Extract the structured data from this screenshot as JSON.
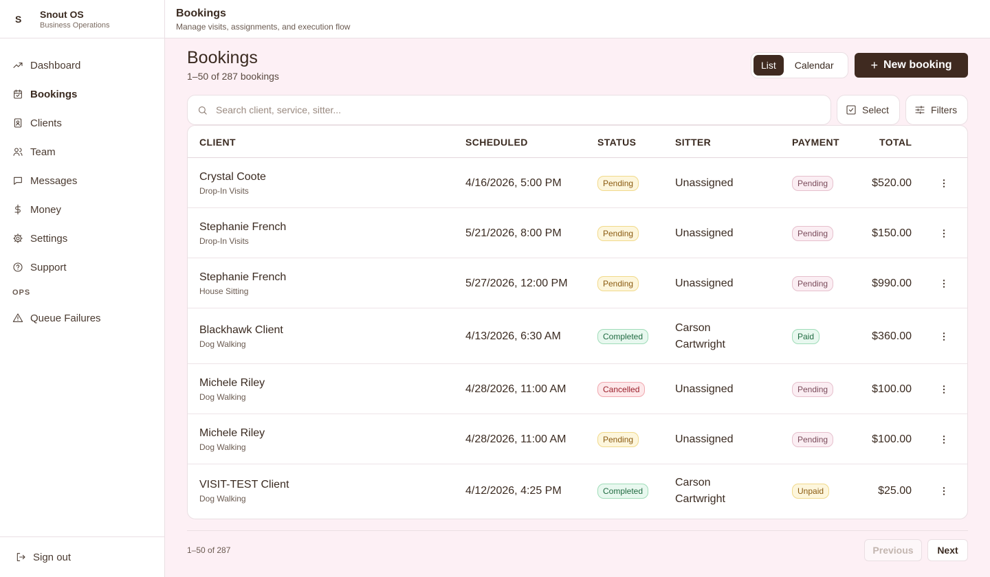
{
  "brand": {
    "mark": "S",
    "name": "Snout OS",
    "subtitle": "Business Operations"
  },
  "sidebar": {
    "items": [
      {
        "label": "Dashboard",
        "icon": "trending-up-icon",
        "active": false
      },
      {
        "label": "Bookings",
        "icon": "calendar-check-icon",
        "active": true
      },
      {
        "label": "Clients",
        "icon": "contact-book-icon",
        "active": false
      },
      {
        "label": "Team",
        "icon": "users-icon",
        "active": false
      },
      {
        "label": "Messages",
        "icon": "message-square-icon",
        "active": false
      },
      {
        "label": "Money",
        "icon": "dollar-icon",
        "active": false
      },
      {
        "label": "Settings",
        "icon": "gear-icon",
        "active": false
      },
      {
        "label": "Support",
        "icon": "help-circle-icon",
        "active": false
      }
    ],
    "section_label": "OPS",
    "ops_items": [
      {
        "label": "Queue Failures",
        "icon": "alert-triangle-icon"
      }
    ],
    "signout_label": "Sign out"
  },
  "header": {
    "title": "Bookings",
    "subtitle": "Manage visits, assignments, and execution flow"
  },
  "main": {
    "title": "Bookings",
    "count": "1–50 of 287 bookings",
    "view_toggle": {
      "list": "List",
      "calendar": "Calendar",
      "selected": "List"
    },
    "new_button": "New booking",
    "search_placeholder": "Search client, service, sitter...",
    "select_label": "Select",
    "filters_label": "Filters"
  },
  "table": {
    "columns": [
      "CLIENT",
      "SCHEDULED",
      "STATUS",
      "SITTER",
      "PAYMENT",
      "TOTAL"
    ],
    "rows": [
      {
        "client": "Crystal Coote",
        "service": "Drop-In Visits",
        "scheduled": "4/16/2026, 5:00 PM",
        "status": "Pending",
        "sitter": "Unassigned",
        "payment": "Pending",
        "total": "$520.00"
      },
      {
        "client": "Stephanie French",
        "service": "Drop-In Visits",
        "scheduled": "5/21/2026, 8:00 PM",
        "status": "Pending",
        "sitter": "Unassigned",
        "payment": "Pending",
        "total": "$150.00"
      },
      {
        "client": "Stephanie French",
        "service": "House Sitting",
        "scheduled": "5/27/2026, 12:00 PM",
        "status": "Pending",
        "sitter": "Unassigned",
        "payment": "Pending",
        "total": "$990.00"
      },
      {
        "client": "Blackhawk Client",
        "service": "Dog Walking",
        "scheduled": "4/13/2026, 6:30 AM",
        "status": "Completed",
        "sitter": "Carson Cartwright",
        "payment": "Paid",
        "total": "$360.00"
      },
      {
        "client": "Michele Riley",
        "service": "Dog Walking",
        "scheduled": "4/28/2026, 11:00 AM",
        "status": "Cancelled",
        "sitter": "Unassigned",
        "payment": "Pending",
        "total": "$100.00"
      },
      {
        "client": "Michele Riley",
        "service": "Dog Walking",
        "scheduled": "4/28/2026, 11:00 AM",
        "status": "Pending",
        "sitter": "Unassigned",
        "payment": "Pending",
        "total": "$100.00"
      },
      {
        "client": "VISIT-TEST Client",
        "service": "Dog Walking",
        "scheduled": "4/12/2026, 4:25 PM",
        "status": "Completed",
        "sitter": "Carson Cartwright",
        "payment": "Unpaid",
        "total": "$25.00"
      }
    ]
  },
  "badge_colors": {
    "status_pending": {
      "bg": "#fdf6dc",
      "border": "#f1d98a",
      "text": "#8a5a10"
    },
    "status_completed": {
      "bg": "#e8f8ef",
      "border": "#9fdcb8",
      "text": "#1f6a40"
    },
    "status_cancelled": {
      "bg": "#fde8ea",
      "border": "#f0a7ae",
      "text": "#9a1f2a"
    },
    "payment_pending": {
      "bg": "#fbeef3",
      "border": "#e6bfcc",
      "text": "#7a4a5a"
    },
    "payment_paid": {
      "bg": "#e8f8ef",
      "border": "#9fdcb8",
      "text": "#1f6a40"
    },
    "payment_unpaid": {
      "bg": "#fdf6dc",
      "border": "#f1d98a",
      "text": "#8a5a10"
    }
  },
  "footer": {
    "count": "1–50 of 287",
    "previous": "Previous",
    "next": "Next"
  }
}
